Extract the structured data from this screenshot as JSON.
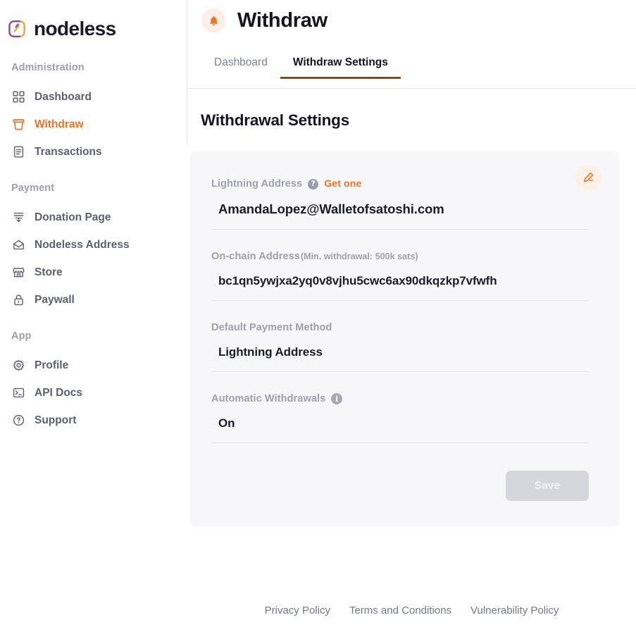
{
  "brand": {
    "name": "nodeless",
    "logo_icon": "nodeless-logo-icon",
    "logo_colors": {
      "left": "#8e4b9e",
      "right": "#e8a33d"
    }
  },
  "sidebar": {
    "sections": [
      {
        "title": "Administration",
        "items": [
          {
            "label": "Dashboard",
            "icon": "grid-icon",
            "active": false
          },
          {
            "label": "Withdraw",
            "icon": "inbox-icon",
            "active": true
          },
          {
            "label": "Transactions",
            "icon": "document-lines-icon",
            "active": false
          }
        ]
      },
      {
        "title": "Payment",
        "items": [
          {
            "label": "Donation Page",
            "icon": "donation-icon",
            "active": false
          },
          {
            "label": "Nodeless Address",
            "icon": "envelope-icon",
            "active": false
          },
          {
            "label": "Store",
            "icon": "storefront-icon",
            "active": false
          },
          {
            "label": "Paywall",
            "icon": "lock-icon",
            "active": false
          }
        ]
      },
      {
        "title": "App",
        "items": [
          {
            "label": "Profile",
            "icon": "gear-icon",
            "active": false
          },
          {
            "label": "API Docs",
            "icon": "terminal-icon",
            "active": false
          },
          {
            "label": "Support",
            "icon": "question-circle-icon",
            "active": false
          }
        ]
      }
    ]
  },
  "header": {
    "icon": "bell-icon",
    "title": "Withdraw"
  },
  "tabs": [
    {
      "label": "Dashboard",
      "active": false
    },
    {
      "label": "Withdraw Settings",
      "active": true
    }
  ],
  "main": {
    "section_title": "Withdrawal Settings",
    "edit_button_icon": "pencil-edit-icon",
    "fields": [
      {
        "label": "Lightning Address",
        "help_icon": "question-circle-icon",
        "link_label": "Get one",
        "value": "AmandaLopez@Walletofsatoshi.com"
      },
      {
        "label": "On-chain Address",
        "label_suffix": "(Min. withdrawal: 500k sats)",
        "value": "bc1qn5ywjxa2yq0v8vjhu5cwc6ax90dkqzkp7vfwfh"
      },
      {
        "label": "Default Payment Method",
        "value": "Lightning Address"
      },
      {
        "label": "Automatic Withdrawals",
        "info_icon": "info-circle-icon",
        "value": "On"
      }
    ],
    "save_label": "Save"
  },
  "footer": {
    "links": [
      "Privacy Policy",
      "Terms and Conditions",
      "Vulnerability Policy"
    ]
  },
  "colors": {
    "accent": "#e8762a",
    "tab_underline": "#8d4a15",
    "card_bg": "#f7f7f9",
    "muted_text": "#9ea0ab",
    "nav_text": "#5c6070"
  }
}
